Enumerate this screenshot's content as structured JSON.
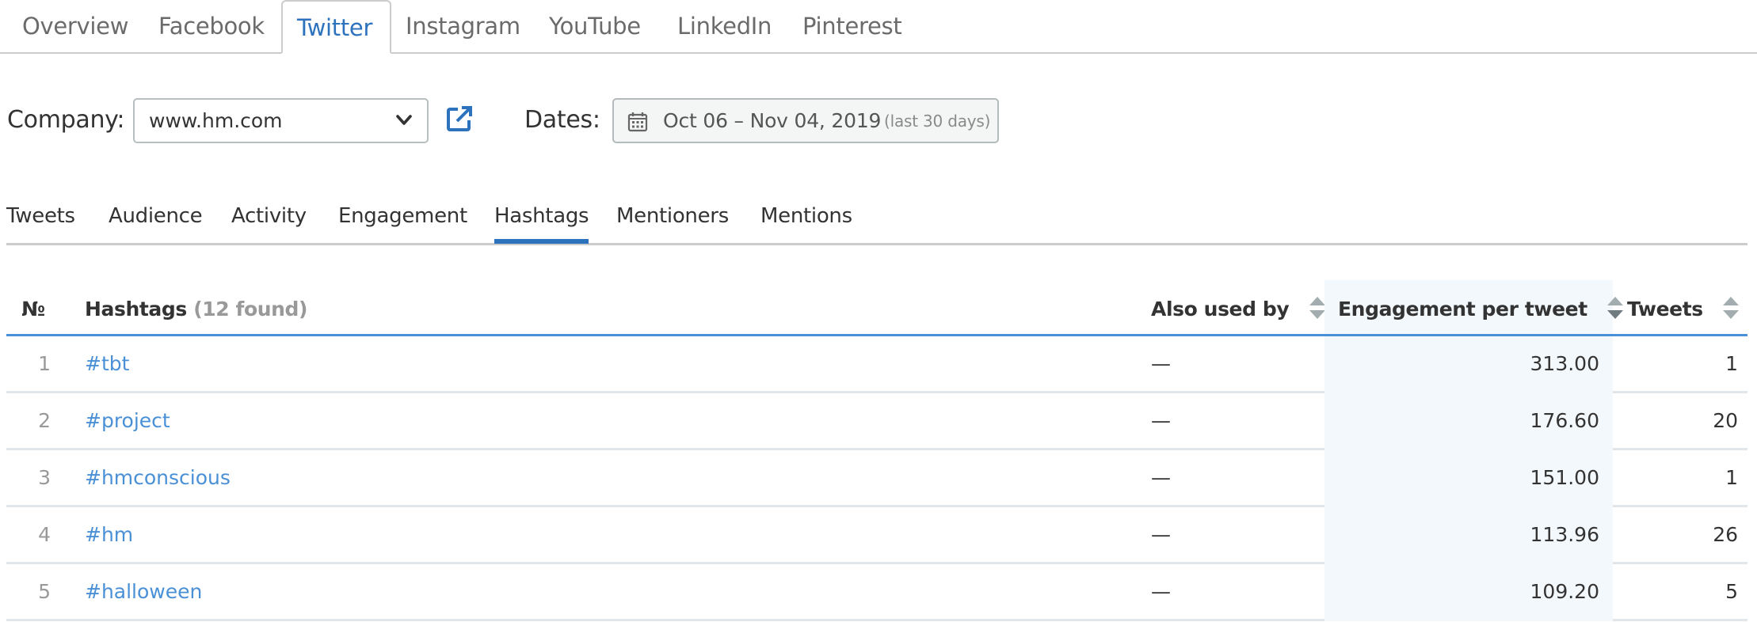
{
  "top_tabs": [
    {
      "label": "Overview",
      "active": false
    },
    {
      "label": "Facebook",
      "active": false
    },
    {
      "label": "Twitter",
      "active": true
    },
    {
      "label": "Instagram",
      "active": false
    },
    {
      "label": "YouTube",
      "active": false
    },
    {
      "label": "LinkedIn",
      "active": false
    },
    {
      "label": "Pinterest",
      "active": false
    }
  ],
  "filters": {
    "company_label": "Company:",
    "company_value": "www.hm.com",
    "external_link_icon": "external-link-icon",
    "dates_label": "Dates:",
    "date_range": "Oct 06 – Nov 04, 2019",
    "date_hint": "(last 30 days)",
    "calendar_icon": "calendar-icon"
  },
  "sub_tabs": [
    {
      "label": "Tweets",
      "active": false
    },
    {
      "label": "Audience",
      "active": false
    },
    {
      "label": "Activity",
      "active": false
    },
    {
      "label": "Engagement",
      "active": false
    },
    {
      "label": "Hashtags",
      "active": true
    },
    {
      "label": "Mentioners",
      "active": false
    },
    {
      "label": "Mentions",
      "active": false
    }
  ],
  "table": {
    "columns": {
      "number": "№",
      "hashtags": "Hashtags",
      "hashtags_count": "(12 found)",
      "also_used_by": "Also used by",
      "engagement": "Engagement per tweet",
      "tweets": "Tweets"
    },
    "sorted_by": "engagement",
    "rows": [
      {
        "n": "1",
        "tag": "#tbt",
        "also_used_by": "—",
        "engagement": "313.00",
        "tweets": "1"
      },
      {
        "n": "2",
        "tag": "#project",
        "also_used_by": "—",
        "engagement": "176.60",
        "tweets": "20"
      },
      {
        "n": "3",
        "tag": "#hmconscious",
        "also_used_by": "—",
        "engagement": "151.00",
        "tweets": "1"
      },
      {
        "n": "4",
        "tag": "#hm",
        "also_used_by": "—",
        "engagement": "113.96",
        "tweets": "26"
      },
      {
        "n": "5",
        "tag": "#halloween",
        "also_used_by": "—",
        "engagement": "109.20",
        "tweets": "5"
      }
    ]
  },
  "colors": {
    "accent": "#2d72bd",
    "link": "#4a90d6",
    "sorted_column_bg": "#f3f8fc",
    "divider": "#cccccc"
  }
}
